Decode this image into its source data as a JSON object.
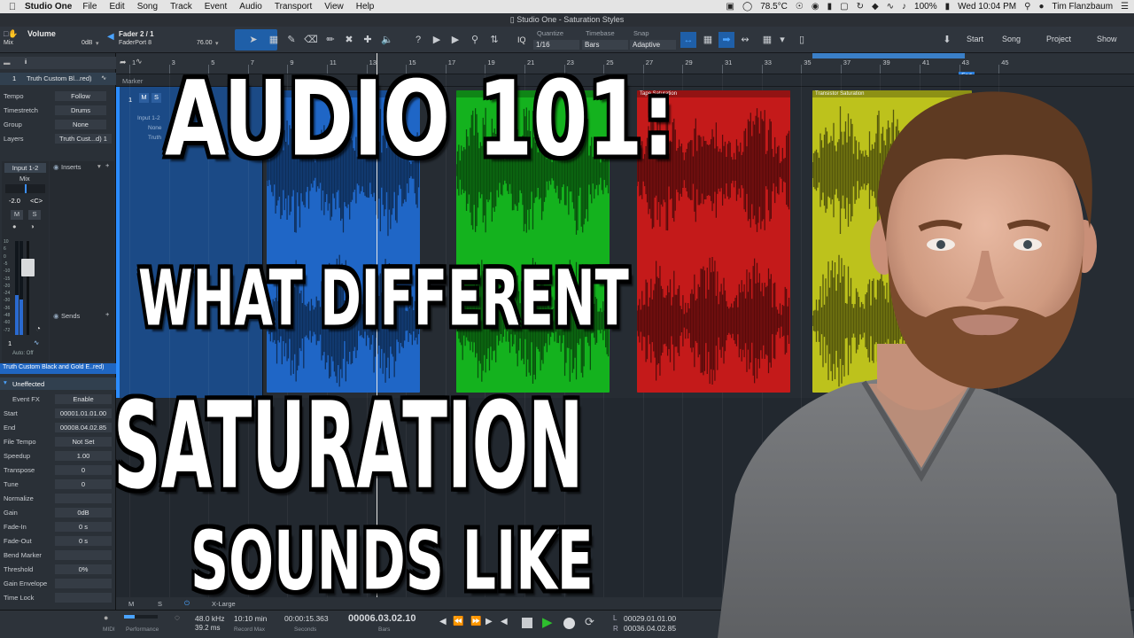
{
  "menubar": {
    "app_name": "Studio One",
    "items": [
      "File",
      "Edit",
      "Song",
      "Track",
      "Event",
      "Audio",
      "Transport",
      "View",
      "Help"
    ],
    "temperature": "78.5°C",
    "battery": "100%",
    "clock": "Wed 10:04 PM",
    "user": "Tim Flanzbaum"
  },
  "window": {
    "title": "Studio One - Saturation Styles"
  },
  "toolbar": {
    "volume_label": "Volume",
    "mix_label": "Mix",
    "volume_value": "0dB",
    "fader_label": "Fader 2 / 1",
    "faderport_label": "FaderPort 8",
    "faderport_value": "76.00",
    "iq_label": "IQ",
    "quantize_label": "Quantize",
    "quantize_value": "1/16",
    "timebase_label": "Timebase",
    "timebase_value": "Bars",
    "snap_label": "Snap",
    "snap_value": "Adaptive",
    "start_button": "Start",
    "song_button": "Song",
    "project_button": "Project",
    "show_button": "Show"
  },
  "inspector": {
    "track_number": "1",
    "track_name": "Truth Custom Bl...red)",
    "rows": [
      {
        "label": "Tempo",
        "value": "Follow"
      },
      {
        "label": "Timestretch",
        "value": "Drums"
      },
      {
        "label": "Group",
        "value": "None"
      },
      {
        "label": "Layers",
        "value": "Truth Cust...d) 1"
      }
    ],
    "input_label": "Input 1-2",
    "mix_label": "Mix",
    "pan_value": "-2.0",
    "pan_center": "<C>",
    "mute": "M",
    "solo": "S",
    "inserts_label": "Inserts",
    "sends_label": "Sends",
    "channel_number": "1",
    "auto_label": "Auto: Off",
    "fader_scale": [
      "10",
      "6",
      "0",
      "-5",
      "-10",
      "-15",
      "-20",
      "-24",
      "-30",
      "-36",
      "-48",
      "-60",
      "-72"
    ],
    "channel_name": "Truth Custom Black and Gold E..red)",
    "event_name": "Uneffected",
    "event_fx_label": "Event FX",
    "event_fx_value": "Enable",
    "event_rows": [
      {
        "label": "Start",
        "value": "00001.01.01.00"
      },
      {
        "label": "End",
        "value": "00008.04.02.85"
      },
      {
        "label": "File Tempo",
        "value": "Not Set"
      },
      {
        "label": "Speedup",
        "value": "1.00"
      },
      {
        "label": "Transpose",
        "value": "0"
      },
      {
        "label": "Tune",
        "value": "0"
      },
      {
        "label": "Normalize",
        "value": ""
      },
      {
        "label": "Gain",
        "value": "0dB"
      },
      {
        "label": "Fade-In",
        "value": "0 s"
      },
      {
        "label": "Fade-Out",
        "value": "0 s"
      },
      {
        "label": "Bend Marker",
        "value": ""
      },
      {
        "label": "Threshold",
        "value": "0%"
      },
      {
        "label": "Gain Envelope",
        "value": ""
      },
      {
        "label": "Time Lock",
        "value": ""
      }
    ]
  },
  "arrangement": {
    "marker_label": "Marker",
    "ruler_ticks": [
      "1",
      "3",
      "5",
      "7",
      "9",
      "11",
      "13",
      "15",
      "17",
      "19",
      "21",
      "23",
      "25",
      "27",
      "29",
      "31",
      "33",
      "35",
      "37",
      "39",
      "41",
      "43",
      "45"
    ],
    "end_label": "End",
    "track_mute": "M",
    "track_solo": "S",
    "track_input_label": "Input 1-2",
    "track_none_label": "None",
    "track_name_short": "Truth",
    "events": [
      {
        "name": "",
        "color": "#1f66c6"
      },
      {
        "name": "",
        "color": "#14b21e"
      },
      {
        "name": "Tape Saturation",
        "color": "#c41a1a"
      },
      {
        "name": "Transistor Saturation",
        "color": "#bdc21c"
      }
    ],
    "lower_label_m": "Mi",
    "lower_label_o": "0d",
    "zoom_label": "X-Large"
  },
  "transport": {
    "midi_label": "MIDI",
    "performance_label": "Performance",
    "sample_rate": "48.0 kHz",
    "latency": "39.2 ms",
    "record_max": "10:10 min",
    "record_max_label": "Record Max",
    "seconds_value": "00:00:15.363",
    "seconds_label": "Seconds",
    "bars_value": "00006.03.02.10",
    "bars_label": "Bars",
    "loop_l": "00029.01.01.00",
    "loop_r": "00036.04.02.85",
    "l_label": "L",
    "r_label": "R"
  },
  "overlay": {
    "line1": "AUDIO 101:",
    "line2": "WHAT DIFFERENT",
    "line3": "SATURATION",
    "line4": "SOUNDS LIKE"
  }
}
